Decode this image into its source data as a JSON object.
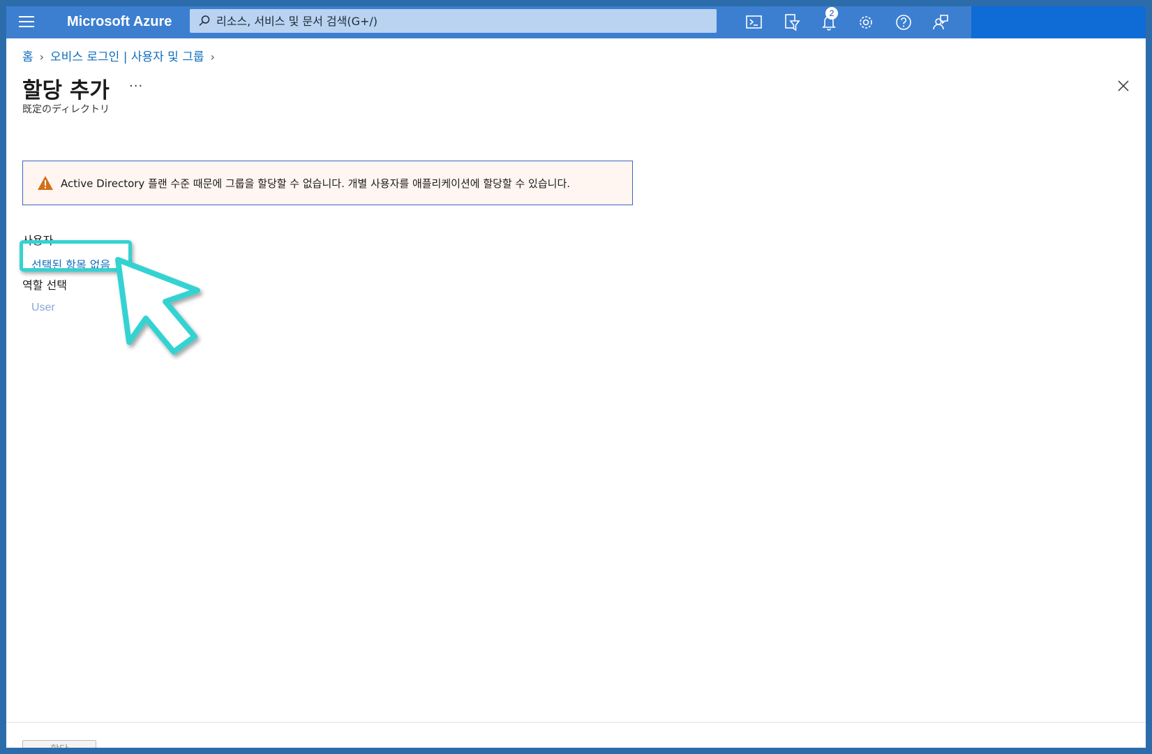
{
  "topbar": {
    "brand": "Microsoft Azure",
    "search_placeholder": "리소스, 서비스 및 문서 검색(G+/)",
    "notification_count": "2",
    "icons": [
      "menu-icon",
      "cloud-shell-icon",
      "directory-filter-icon",
      "notifications-icon",
      "settings-icon",
      "help-icon",
      "feedback-icon"
    ]
  },
  "breadcrumb": {
    "home": "홈",
    "parent": "오비스 로그인 | 사용자 및 그룹"
  },
  "page": {
    "title": "할당 추가",
    "more": "···",
    "subtitle": "既定のディレクトリ"
  },
  "warning": {
    "text": "Active Directory 플랜 수준 때문에 그룹을 할당할 수 없습니다. 개별 사용자를 애플리케이션에 할당할 수 있습니다."
  },
  "form": {
    "users_label": "사용자",
    "users_value": "선택된 항목 없음",
    "role_label": "역할 선택",
    "role_value": "User"
  },
  "footer": {
    "button_label": "할당"
  },
  "colors": {
    "topbar": "#3c7fd0",
    "link": "#0f6cbd",
    "highlight": "#35d2d2",
    "warning_bg": "#fff6f1"
  }
}
